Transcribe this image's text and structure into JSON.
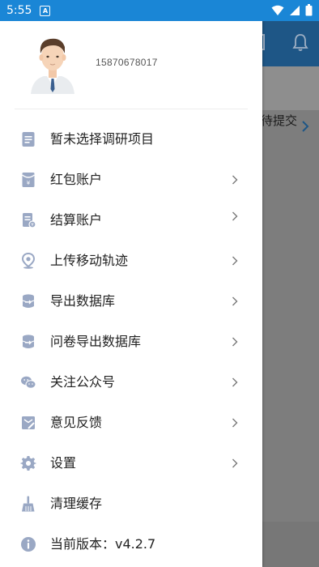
{
  "statusbar": {
    "time": "5:55",
    "notification_badge": "A"
  },
  "background": {
    "pending_text": "待提交"
  },
  "profile": {
    "phone": "15870678017"
  },
  "menu": [
    {
      "label": "暂未选择调研项目",
      "icon": "document-list-icon",
      "has_arrow": false
    },
    {
      "label": "红包账户",
      "icon": "red-envelope-icon",
      "has_arrow": true
    },
    {
      "label": "结算账户",
      "icon": "receipt-icon",
      "has_arrow": true
    },
    {
      "label": "上传移动轨迹",
      "icon": "location-pin-icon",
      "has_arrow": true
    },
    {
      "label": "导出数据库",
      "icon": "database-export-icon",
      "has_arrow": true
    },
    {
      "label": "问卷导出数据库",
      "icon": "database-export-icon",
      "has_arrow": true
    },
    {
      "label": "关注公众号",
      "icon": "wechat-icon",
      "has_arrow": true
    },
    {
      "label": "意见反馈",
      "icon": "feedback-icon",
      "has_arrow": true
    },
    {
      "label": "设置",
      "icon": "gear-icon",
      "has_arrow": true
    },
    {
      "label": "清理缓存",
      "icon": "broom-icon",
      "has_arrow": false
    },
    {
      "label": "当前版本：v4.2.7",
      "icon": "info-icon",
      "has_arrow": false
    }
  ],
  "colors": {
    "statusbar": "#1a86d6",
    "icon": "#9aa8c4",
    "text": "#222222"
  }
}
